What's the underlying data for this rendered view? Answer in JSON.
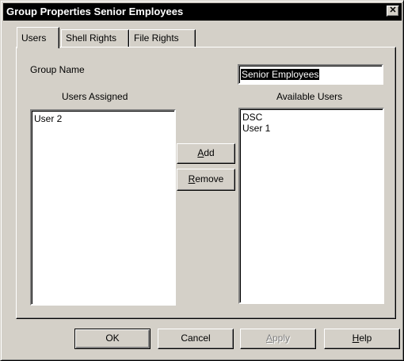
{
  "window": {
    "title": "Group Properties Senior Employees",
    "close_glyph": "✕"
  },
  "tabs": [
    {
      "label": "Users",
      "active": true
    },
    {
      "label": "Shell Rights",
      "active": false
    },
    {
      "label": "File Rights",
      "active": false
    }
  ],
  "group_name": {
    "label": "Group Name",
    "value": "Senior Employees"
  },
  "users_assigned": {
    "label": "Users Assigned",
    "items": [
      "User 2"
    ]
  },
  "available_users": {
    "label": "Available Users",
    "items": [
      "DSC",
      "User 1"
    ]
  },
  "actions": {
    "add": {
      "pre": "",
      "mn": "A",
      "post": "dd"
    },
    "remove": {
      "pre": "",
      "mn": "R",
      "post": "emove"
    }
  },
  "footer": {
    "ok": "OK",
    "cancel": "Cancel",
    "apply": {
      "pre": "",
      "mn": "A",
      "post": "pply",
      "enabled": false
    },
    "help": {
      "pre": "",
      "mn": "H",
      "post": "elp"
    }
  },
  "colors": {
    "face": "#d4d0c8",
    "titlebar": "#000000",
    "selection": "#000000",
    "disabled_text": "#808080"
  }
}
